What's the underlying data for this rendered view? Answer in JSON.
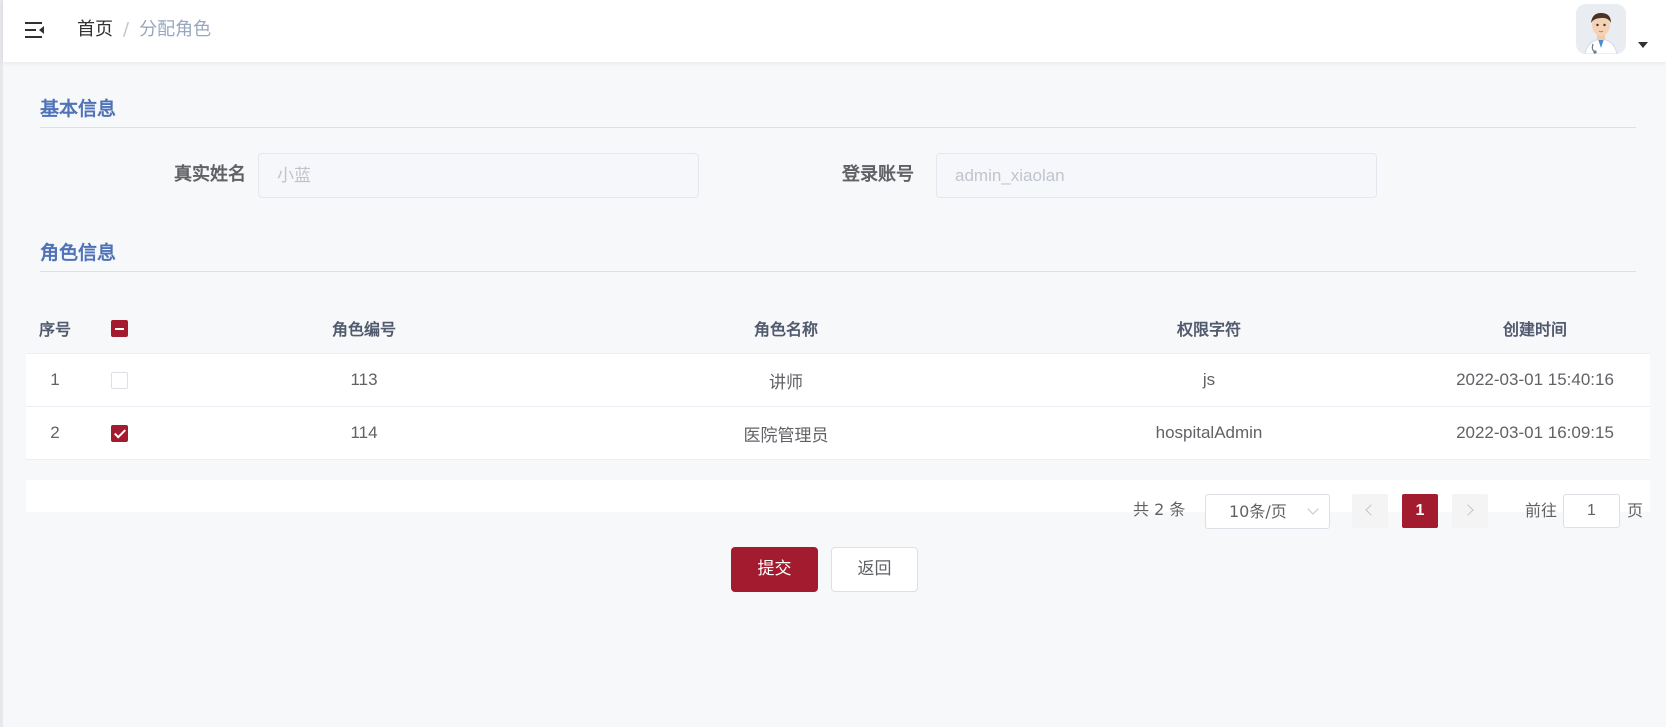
{
  "navbar": {
    "breadcrumb": {
      "home": "首页",
      "separator": "/",
      "current": "分配角色"
    }
  },
  "sections": {
    "basic_info": "基本信息",
    "role_info": "角色信息"
  },
  "form": {
    "real_name_label": "真实姓名",
    "real_name_value": "小蓝",
    "login_account_label": "登录账号",
    "login_account_value": "admin_xiaolan"
  },
  "table": {
    "headers": {
      "index": "序号",
      "role_code": "角色编号",
      "role_name": "角色名称",
      "permission": "权限字符",
      "created": "创建时间"
    },
    "rows": [
      {
        "index": "1",
        "checked": false,
        "role_code": "113",
        "role_name": "讲师",
        "permission": "js",
        "created": "2022-03-01 15:40:16"
      },
      {
        "index": "2",
        "checked": true,
        "role_code": "114",
        "role_name": "医院管理员",
        "permission": "hospitalAdmin",
        "created": "2022-03-01 16:09:15"
      }
    ]
  },
  "pagination": {
    "total": "共 2 条",
    "page_size": "10条/页",
    "current_page": "1",
    "goto_label": "前往",
    "goto_value": "1",
    "page_suffix": "页"
  },
  "actions": {
    "submit": "提交",
    "back": "返回"
  },
  "colors": {
    "accent": "#a31b2e",
    "section_title": "#4f72b8"
  }
}
